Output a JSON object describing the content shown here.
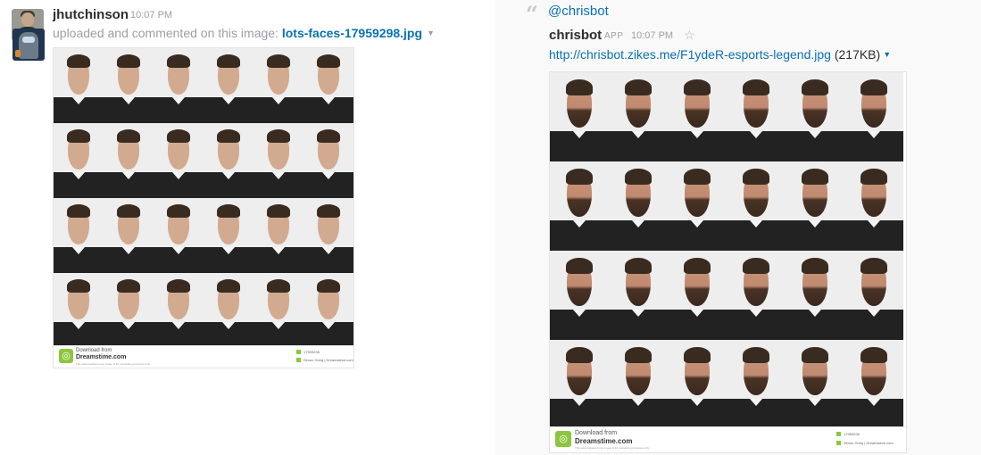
{
  "left_message": {
    "username": "jhutchinson",
    "time": "10:07 PM",
    "action_text": "uploaded and commented on this image: ",
    "file_name": "lots-faces-17959298.jpg",
    "avatar_icon": "user-avatar-photo"
  },
  "right_message": {
    "quote_icon": "quote-icon",
    "mention": "@chrisbot",
    "username": "chrisbot",
    "app_badge": "APP",
    "time": "10:07 PM",
    "star_icon": "star-outline-icon",
    "url": "http://chrisbot.zikes.me/F1ydeR-esports-legend.jpg",
    "file_size": "(217KB)",
    "avatar_icon": "robot-avatar-icon"
  },
  "watermark": {
    "download_from": "Download from",
    "site": "Dreamstime.com",
    "fine_print": "This watermarked comp image is for previewing purposes only.",
    "image_id": "17959298",
    "credit": "Simon Greig | Dreamstime.com"
  },
  "colors": {
    "link": "#0a71b3",
    "muted": "#9e9ea6",
    "text": "#2c2d30",
    "right_panel_bg": "#f9f9f9",
    "dreamstime_green": "#8cc63f"
  }
}
